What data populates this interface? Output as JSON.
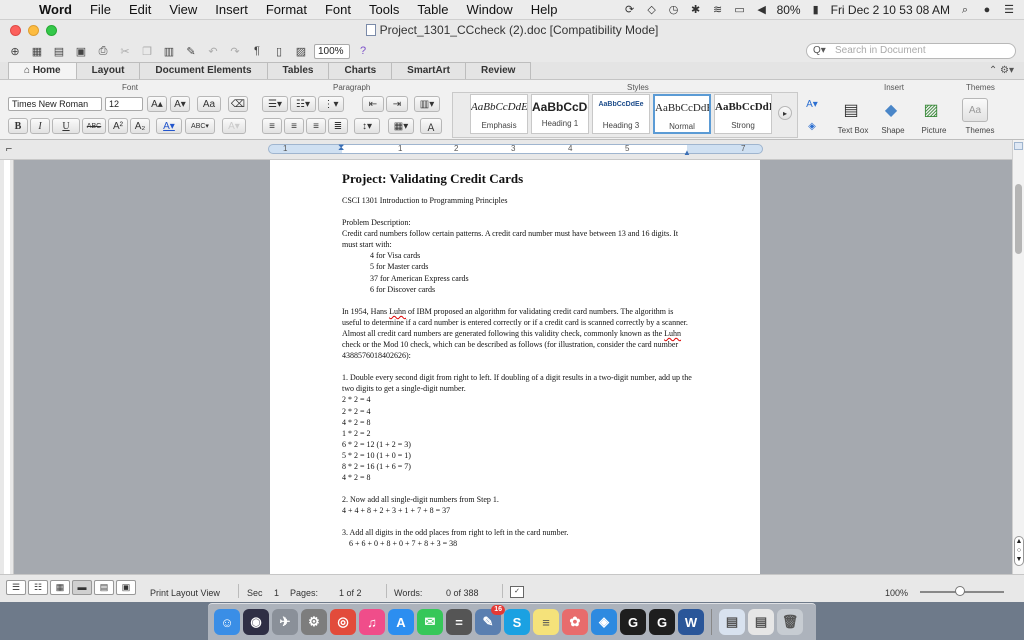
{
  "menubar": {
    "apple_glyph": "",
    "items": [
      "Word",
      "File",
      "Edit",
      "View",
      "Insert",
      "Format",
      "Font",
      "Tools",
      "Table",
      "Window",
      "Help"
    ],
    "battery": "80%",
    "clock": "Fri Dec 2  10 53 08 AM"
  },
  "window": {
    "title": "Project_1301_CCcheck (2).doc [Compatibility Mode]"
  },
  "toolbar": {
    "zoom": "100%",
    "search_placeholder": "Search in Document",
    "pilcrow": "¶"
  },
  "ribbon_tabs": [
    "Home",
    "Layout",
    "Document Elements",
    "Tables",
    "Charts",
    "SmartArt",
    "Review"
  ],
  "ribbon": {
    "groups": {
      "font": "Font",
      "paragraph": "Paragraph",
      "styles": "Styles",
      "insert": "Insert",
      "themes": "Themes"
    },
    "font_name": "Times New Roman",
    "font_size": "12",
    "bold": "B",
    "italic": "I",
    "underline": "U",
    "strike": "ABC",
    "superscript": "A²",
    "subscript": "A₂",
    "styles": [
      {
        "sample": "AaBbCcDdEe",
        "name": "Emphasis",
        "italic": true
      },
      {
        "sample": "AaBbCcDd",
        "name": "Heading 1",
        "bold": true
      },
      {
        "sample": "AaBbCcDdEe",
        "name": "Heading 3",
        "small": true
      },
      {
        "sample": "AaBbCcDdE",
        "name": "Normal",
        "active": true
      },
      {
        "sample": "AaBbCcDdI",
        "name": "Strong",
        "bold": true
      }
    ],
    "insert_items": [
      "Text Box",
      "Shape",
      "Picture"
    ],
    "themes_label": "Themes"
  },
  "ruler_numbers": [
    "1",
    "1",
    "2",
    "3",
    "4",
    "5",
    "6",
    "7"
  ],
  "document": {
    "title": "Project: Validating Credit Cards",
    "course": "CSCI 1301 Introduction to Programming Principles",
    "problem_heading": "Problem Description:",
    "intro": "Credit card numbers follow certain patterns. A credit card number must have between 13 and 16 digits. It must start with:",
    "card_prefixes": [
      "4 for Visa cards",
      "5 for Master cards",
      "37 for American Express cards",
      "6 for Discover cards"
    ],
    "luhn_paragraph_pre": "In 1954, Hans ",
    "luhn_word": "Luhn",
    "luhn_paragraph_mid": " of IBM proposed an algorithm for validating credit card numbers. The algorithm is useful to determine if a card number is entered correctly or if a credit card is scanned correctly by a scanner. Almost all credit card numbers are generated following this validity check, commonly known as the ",
    "luhn_word2": "Luhn",
    "luhn_paragraph_post": " check or the Mod 10 check, which can be described as follows (for illustration, consider the card number 4388576018402626):",
    "step1": "1. Double every second digit from right to left. If doubling of a digit results in a two-digit number, add up the two digits to get a single-digit number.",
    "step1_lines": [
      "2 * 2 = 4",
      "2 * 2 = 4",
      "4 * 2 = 8",
      "1 * 2 = 2",
      "6 * 2 = 12 (1 + 2 = 3)",
      "5 * 2 = 10 (1 + 0 = 1)",
      "8 * 2 = 16 (1 + 6 = 7)",
      "4 * 2 = 8"
    ],
    "step2": "2. Now add all single-digit numbers from Step 1.",
    "step2_line": "4 + 4 + 8 + 2 + 3 + 1 + 7 + 8 = 37",
    "step3": "3. Add all digits in the odd places from right to left in the card number.",
    "step3_line": "6 + 6 + 0 + 8 + 0 + 7 + 8 + 3 = 38"
  },
  "status": {
    "view_name": "Print Layout View",
    "sec_label": "Sec",
    "sec_value": "1",
    "pages_label": "Pages:",
    "pages_value": "1 of 2",
    "words_label": "Words:",
    "words_value": "0 of 388",
    "zoom": "100%"
  },
  "dock": {
    "badge": "16",
    "apps": [
      {
        "name": "finder-icon",
        "color": "#3a8ee6",
        "glyph": "☺"
      },
      {
        "name": "siri-icon",
        "color": "#2f2f45",
        "glyph": "◉"
      },
      {
        "name": "launchpad-icon",
        "color": "#8a9099",
        "glyph": "✈"
      },
      {
        "name": "system-preferences-icon",
        "color": "#7d7d7d",
        "glyph": "⚙"
      },
      {
        "name": "chrome-icon",
        "color": "#e24b3b",
        "glyph": "◎"
      },
      {
        "name": "itunes-icon",
        "color": "#f04d8a",
        "glyph": "♫"
      },
      {
        "name": "app-store-icon",
        "color": "#2c8ef0",
        "glyph": "A"
      },
      {
        "name": "messages-icon",
        "color": "#36c759",
        "glyph": "✉"
      },
      {
        "name": "calculator-icon",
        "color": "#555",
        "glyph": "="
      },
      {
        "name": "preview-icon",
        "color": "#5a7fb0",
        "glyph": "✎"
      },
      {
        "name": "skype-icon",
        "color": "#1ba1e2",
        "glyph": "S"
      },
      {
        "name": "notes-icon",
        "color": "#f5e27a",
        "glyph": "≡"
      },
      {
        "name": "photos-icon",
        "color": "#e86c6c",
        "glyph": "✿"
      },
      {
        "name": "safari-icon",
        "color": "#2d8ae0",
        "glyph": "◈"
      },
      {
        "name": "gradebook-g-icon",
        "color": "#1e1e1e",
        "glyph": "G"
      },
      {
        "name": "gradebook-g2-icon",
        "color": "#1e1e1e",
        "glyph": "G"
      },
      {
        "name": "word-icon",
        "color": "#2a5699",
        "glyph": "W"
      },
      {
        "name": "document-icon",
        "color": "#d8e2ef",
        "glyph": "▤"
      },
      {
        "name": "document-2-icon",
        "color": "#e6e6e6",
        "glyph": "▤"
      },
      {
        "name": "trash-icon",
        "color": "#c7ccd2",
        "glyph": "🗑"
      }
    ]
  }
}
